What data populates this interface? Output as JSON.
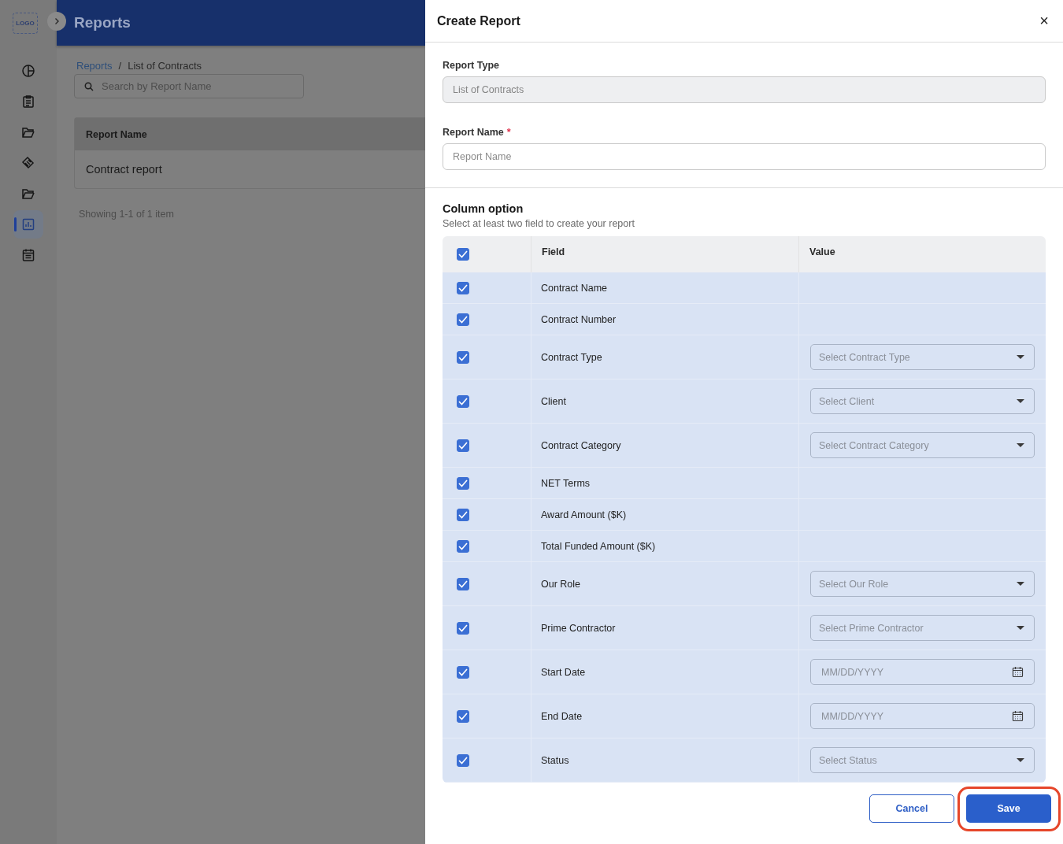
{
  "app": {
    "logo": "LOGO",
    "title": "Reports"
  },
  "sidebar": {
    "items": [
      {
        "selected": false
      },
      {
        "selected": false
      },
      {
        "selected": false
      },
      {
        "selected": false
      },
      {
        "selected": false
      },
      {
        "selected": true
      },
      {
        "selected": false
      }
    ]
  },
  "breadcrumb": {
    "items": [
      "Reports",
      "List of Contracts"
    ],
    "separator": "/"
  },
  "search": {
    "placeholder": "Search by Report Name"
  },
  "table": {
    "columns": [
      "Report Name"
    ],
    "rows": [
      [
        "Contract report"
      ]
    ],
    "footer": "Showing 1-1 of 1 item"
  },
  "dialog": {
    "title": "Create Report",
    "close": "×",
    "report_type": {
      "label": "Report Type",
      "value": "List of Contracts"
    },
    "report_name": {
      "label": "Report Name",
      "required": "*",
      "placeholder": "Report Name"
    },
    "column_option": {
      "title": "Column option",
      "hint": "Select at least two field to create your report",
      "header": {
        "checked": true,
        "field": "Field",
        "value": "Value"
      },
      "rows": [
        {
          "field": "Contract Name",
          "checked": true,
          "kind": "plain"
        },
        {
          "field": "Contract Number",
          "checked": true,
          "kind": "plain"
        },
        {
          "field": "Contract Type",
          "checked": true,
          "kind": "select",
          "placeholder": "Select Contract Type"
        },
        {
          "field": "Client",
          "checked": true,
          "kind": "select",
          "placeholder": "Select Client"
        },
        {
          "field": "Contract Category",
          "checked": true,
          "kind": "select",
          "placeholder": "Select Contract Category"
        },
        {
          "field": "NET Terms",
          "checked": true,
          "kind": "plain"
        },
        {
          "field": "Award Amount ($K)",
          "checked": true,
          "kind": "plain"
        },
        {
          "field": "Total Funded Amount ($K)",
          "checked": true,
          "kind": "plain"
        },
        {
          "field": "Our Role",
          "checked": true,
          "kind": "select",
          "placeholder": "Select Our Role"
        },
        {
          "field": "Prime Contractor",
          "checked": true,
          "kind": "select",
          "placeholder": "Select Prime Contractor"
        },
        {
          "field": "Start Date",
          "checked": true,
          "kind": "date",
          "placeholder": "MM/DD/YYYY"
        },
        {
          "field": "End Date",
          "checked": true,
          "kind": "date",
          "placeholder": "MM/DD/YYYY"
        },
        {
          "field": "Status",
          "checked": true,
          "kind": "select",
          "placeholder": "Select Status"
        }
      ]
    },
    "buttons": [
      {
        "label": "Cancel",
        "kind": "secondary"
      },
      {
        "label": "Save",
        "kind": "primary",
        "highlighted": true
      }
    ]
  }
}
